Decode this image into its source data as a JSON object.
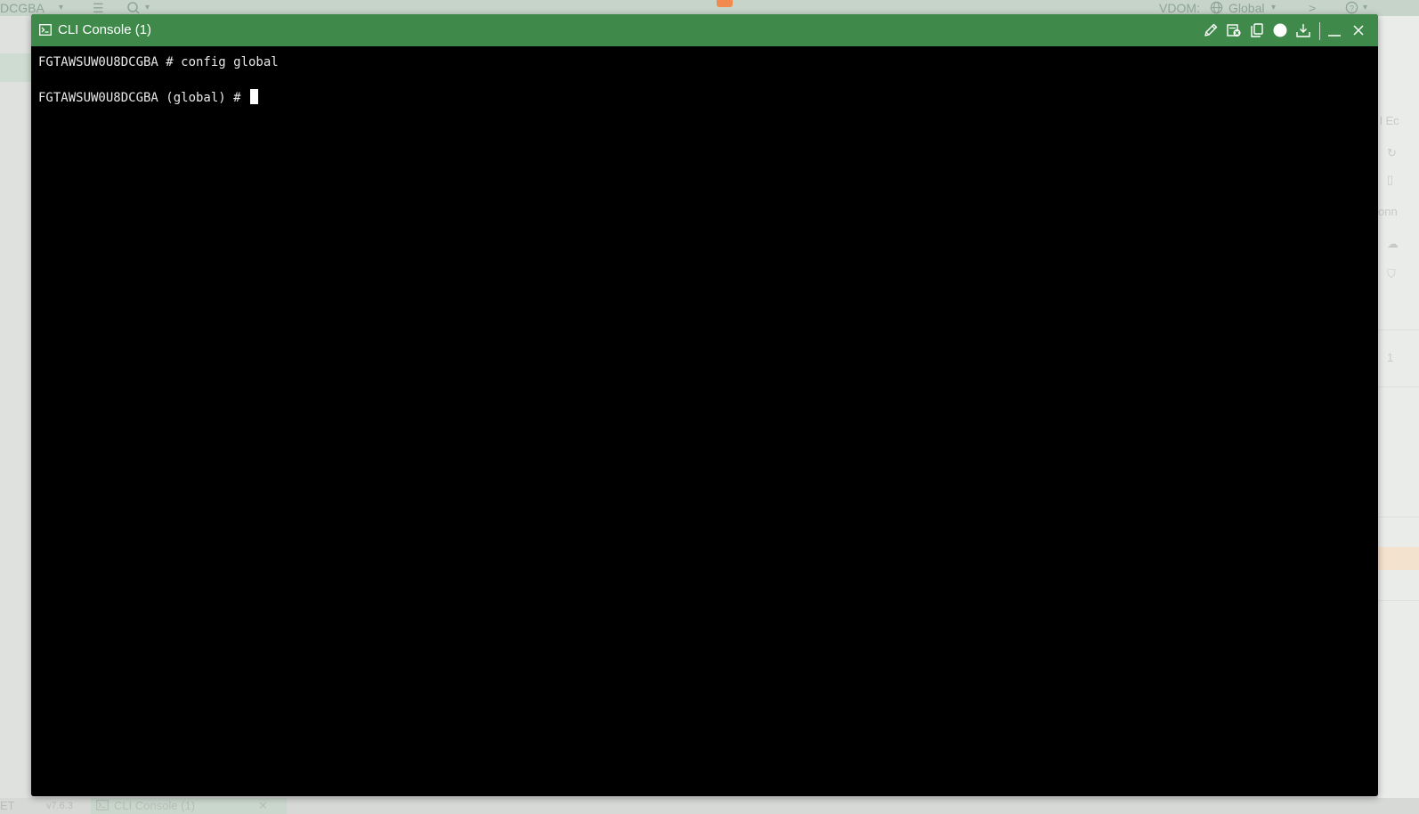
{
  "background": {
    "topbar": {
      "hostname": "DCGBA",
      "vdom_label": "VDOM:",
      "vdom_value": "Global"
    },
    "right_panel": {
      "snippet_1": "l Ec",
      "snippet_2": "onn",
      "snippet_3": "1"
    },
    "bottombar": {
      "left_text": "ET",
      "version": "v7.6.3",
      "tab_label": "CLI Console (1)"
    }
  },
  "console": {
    "title": "CLI Console (1)",
    "toolbar": {
      "edit": "pencil-icon",
      "clear": "clear-console-icon",
      "copy": "copy-icon",
      "status": "status-dot-icon",
      "download": "download-icon",
      "minimize": "minimize-icon",
      "close": "close-icon"
    },
    "lines": [
      "FGTAWSUW0U8DCGBA # config global",
      "FGTAWSUW0U8DCGBA (global) # "
    ]
  },
  "colors": {
    "titlebar": "#3f8a4b",
    "terminal_bg": "#000000",
    "terminal_text": "#e8e8e8",
    "brand_accent": "#f08a4e"
  }
}
